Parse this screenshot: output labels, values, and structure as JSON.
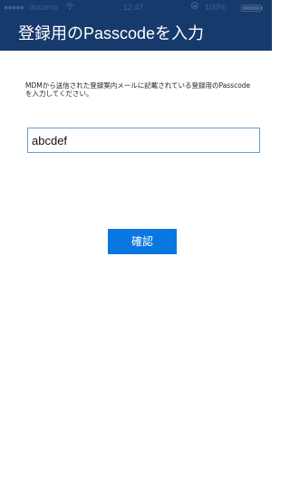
{
  "status_bar": {
    "signal": "●●●●●",
    "carrier": "docomo",
    "wifi_icon": "wifi-icon",
    "time": "12:47",
    "lock_icon": "orientation-lock-icon",
    "battery_text": "100%",
    "battery_level": 1.0
  },
  "header": {
    "title": "登録用のPasscodeを入力"
  },
  "main": {
    "instruction": "MDMから送信された登録案内メールに記載されている登録用のPasscodeを入力してください。",
    "passcode_value": "abcdef",
    "confirm_label": "確認"
  },
  "colors": {
    "header_bg": "#163a6b",
    "button_bg": "#0a77e0",
    "input_border": "#6e9bd0"
  }
}
